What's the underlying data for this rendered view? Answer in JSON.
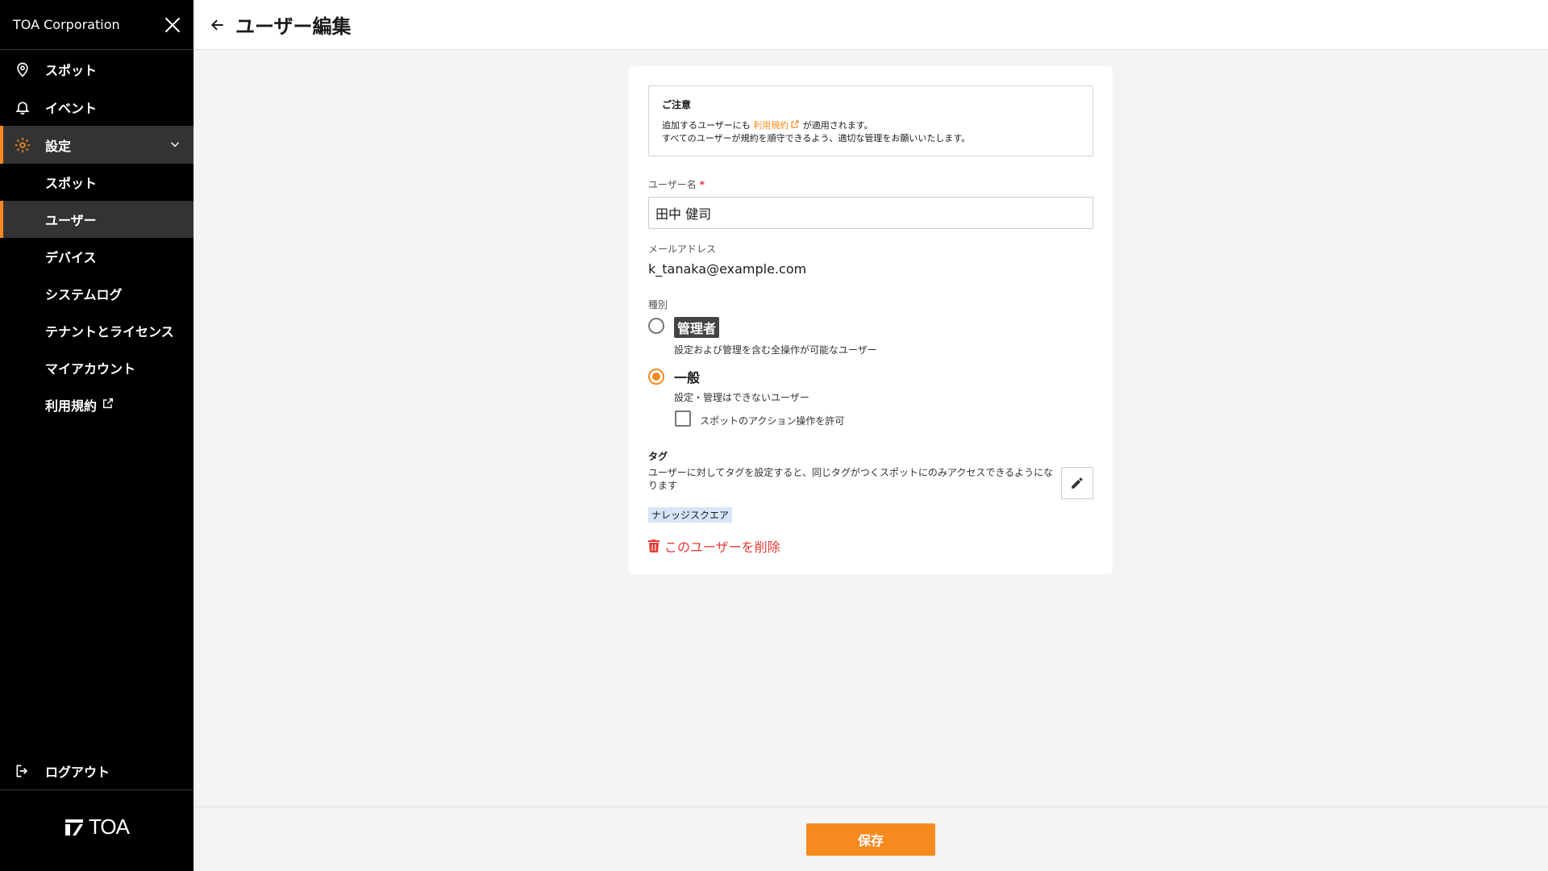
{
  "sidebar": {
    "org_name": "TOA Corporation",
    "nav": {
      "spot": "スポット",
      "event": "イベント",
      "settings": "設定"
    },
    "sub": {
      "spot": "スポット",
      "user": "ユーザー",
      "device": "デバイス",
      "system_log": "システムログ",
      "tenant_license": "テナントとライセンス",
      "my_account": "マイアカウント",
      "terms": "利用規約"
    },
    "logout": "ログアウト",
    "logo": "TOA"
  },
  "header": {
    "title": "ユーザー編集"
  },
  "notice": {
    "title": "ご注意",
    "line1_before": "追加するユーザーにも",
    "line1_link": "利用規約",
    "line1_after": "が適用されます。",
    "line2": "すべてのユーザーが規約を順守できるよう、適切な管理をお願いいたします。"
  },
  "form": {
    "username_label": "ユーザー名",
    "required_mark": "*",
    "username_value": "田中 健司",
    "email_label": "メールアドレス",
    "email_value": "k_tanaka@example.com",
    "type_label": "種別",
    "admin_label": "管理者",
    "admin_desc": "設定および管理を含む全操作が可能なユーザー",
    "general_label": "一般",
    "general_desc": "設定・管理はできないユーザー",
    "spot_action_label": "スポットのアクション操作を許可",
    "selected_type": "一般",
    "spot_action_checked": false
  },
  "tags": {
    "title": "タグ",
    "description": "ユーザーに対してタグを設定すると、同じタグがつくスポットにのみアクセスできるようになります",
    "items": [
      "ナレッジスクエア"
    ]
  },
  "actions": {
    "delete": "このユーザーを削除",
    "save": "保存"
  },
  "colors": {
    "accent": "#f58a1f",
    "danger": "#e53935",
    "sidebar_bg": "#000000",
    "tag_bg": "#d6e6f7"
  }
}
